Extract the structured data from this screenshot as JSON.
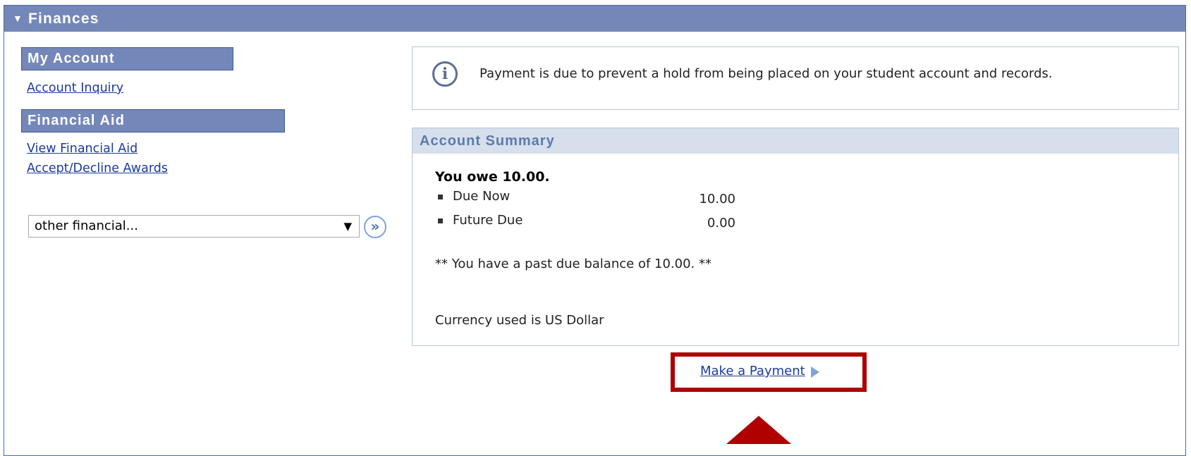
{
  "header": {
    "title": "Finances",
    "arrow_icon": "triangle-down-icon"
  },
  "sidebar": {
    "sections": [
      {
        "title": "My Account",
        "links": [
          "Account Inquiry"
        ]
      },
      {
        "title": "Financial Aid",
        "links": [
          "View Financial Aid",
          "Accept/Decline Awards"
        ]
      }
    ],
    "select": {
      "value": "other financial...",
      "go_icon": "double-chevron-right-icon"
    }
  },
  "notice": {
    "icon": "info-icon",
    "text": "Payment is due to prevent a hold from being placed on your student account and records."
  },
  "summary": {
    "title": "Account Summary",
    "owe_text": "You owe 10.00.",
    "items": [
      {
        "label": "Due Now",
        "amount": "10.00"
      },
      {
        "label": "Future Due",
        "amount": "0.00"
      }
    ],
    "past_due": "** You have a past due balance of 10.00. **",
    "currency": "Currency used is US Dollar"
  },
  "payment": {
    "link": "Make a Payment",
    "arrow_icon": "triangle-right-icon"
  },
  "colors": {
    "header_bg": "#7487b9",
    "highlight": "#b00000",
    "link": "#1c3a9e"
  }
}
